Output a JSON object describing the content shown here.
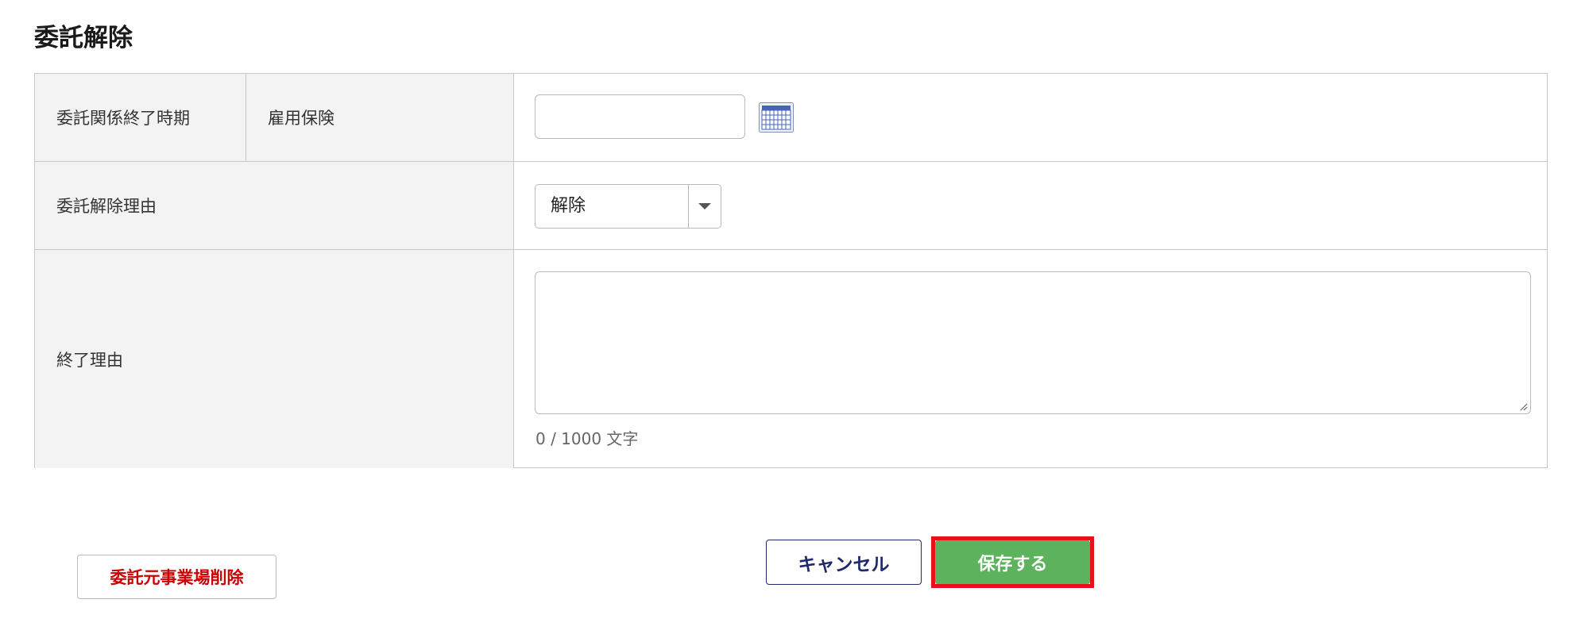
{
  "page": {
    "title": "委託解除"
  },
  "form": {
    "end_period": {
      "label": "委託関係終了時期",
      "sub_label": "雇用保険",
      "date_value": "",
      "calendar_icon": "calendar-icon"
    },
    "release_reason": {
      "label": "委託解除理由",
      "selected": "解除",
      "arrow_icon": "caret-down-icon"
    },
    "end_reason": {
      "label": "終了理由",
      "value": "",
      "char_count": "0 / 1000 文字"
    }
  },
  "actions": {
    "delete_label": "委託元事業場削除",
    "cancel_label": "キャンセル",
    "save_label": "保存する"
  },
  "colors": {
    "save_button": "#5cb25d",
    "highlight": "#e8101a",
    "cancel_border": "#1f2a6b",
    "delete_text": "#cc0000",
    "label_bg": "#f3f3f3"
  }
}
